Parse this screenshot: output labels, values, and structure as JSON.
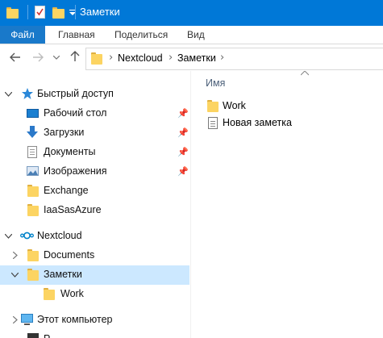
{
  "window": {
    "title": "Заметки"
  },
  "ribbon": {
    "tabs": [
      "Файл",
      "Главная",
      "Поделиться",
      "Вид"
    ]
  },
  "address": {
    "path": [
      "Nextcloud",
      "Заметки"
    ]
  },
  "nav": {
    "quick_access": "Быстрый доступ",
    "quick_items": [
      "Рабочий стол",
      "Загрузки",
      "Документы",
      "Изображения",
      "Exchange",
      "IaaSasAzure"
    ],
    "nextcloud": "Nextcloud",
    "nextcloud_items": [
      "Documents",
      "Заметки",
      "Work"
    ],
    "this_pc": "Этот компьютер",
    "partial_item": "Р"
  },
  "content": {
    "column_header": "Имя",
    "files": [
      {
        "name": "Work",
        "icon": "folder-icon"
      },
      {
        "name": "Новая заметка",
        "icon": "text-file-icon"
      }
    ]
  },
  "colors": {
    "titlebar": "#0078d7",
    "file_tab": "#1979ca",
    "selected_row": "#cce8ff",
    "folder": "#fcd462"
  }
}
